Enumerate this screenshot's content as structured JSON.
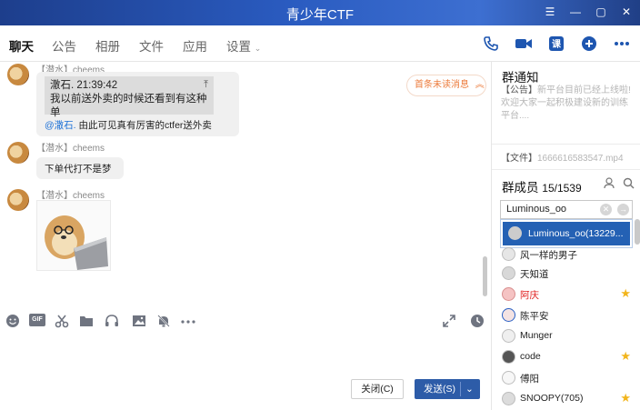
{
  "window": {
    "title": "青少年CTF",
    "buttons": [
      "☰",
      "—",
      "▢",
      "✕"
    ]
  },
  "tabs": [
    {
      "label": "聊天",
      "active": true
    },
    {
      "label": "公告"
    },
    {
      "label": "相册"
    },
    {
      "label": "文件"
    },
    {
      "label": "应用"
    },
    {
      "label": "设置",
      "has_dropdown": true
    }
  ],
  "top_icons": [
    "phone-icon",
    "video-call-icon",
    "lesson-icon",
    "add-icon",
    "more-icon"
  ],
  "chat": {
    "messages": [
      {
        "sender": "【潜水】cheems",
        "quote_line1": "潵石.   21:39:42",
        "quote_line2": "我以前送外卖的时候还看到有这种单",
        "mention": "@潵石.",
        "text": "由此可见真有厉害的ctfer送外卖"
      },
      {
        "sender": "【潜水】cheems",
        "text": "下单代打不是梦"
      },
      {
        "sender": "【潜水】cheems",
        "image": "cheems-laptop-sticker"
      }
    ],
    "unread_notice": "首条未读消息",
    "unread_icon": "double-chevron-up-icon"
  },
  "toolbar": {
    "left_icons": [
      "emoji-icon",
      "gif-icon",
      "screenshot-icon",
      "folder-icon",
      "music-icon",
      "image-icon",
      "mute-icon",
      "more-icon"
    ],
    "gif_label": "GIF",
    "right_icons": [
      "expand-icon",
      "history-icon"
    ]
  },
  "buttons": {
    "close": "关闭(C)",
    "send": "发送(S)"
  },
  "panel": {
    "notice_title": "群通知",
    "notice_tag": "【公告】",
    "notice_text": "新平台目前已经上线啦!",
    "notice_text2": "欢迎大家一起积极建设新的训练平台....",
    "file_tag": "【文件】",
    "file_name": "1666616583547.mp4",
    "members_title": "群成员",
    "members_count": "15/1539",
    "search_value": "Luminous_oo",
    "dropdown_result": "Luminous_oo(13229...",
    "members": [
      {
        "name": "风一样的男子"
      },
      {
        "name": "天知道"
      },
      {
        "name": "阿庆",
        "highlight": true,
        "star": true
      },
      {
        "name": "陈平安"
      },
      {
        "name": "Munger"
      },
      {
        "name": "code",
        "star": true
      },
      {
        "name": "傅阳"
      },
      {
        "name": "SNOOPY(705)",
        "star": true
      }
    ],
    "colors": {
      "accent": "#2461b4",
      "star": "#f2b51c",
      "highlight_name": "#e02020"
    }
  }
}
